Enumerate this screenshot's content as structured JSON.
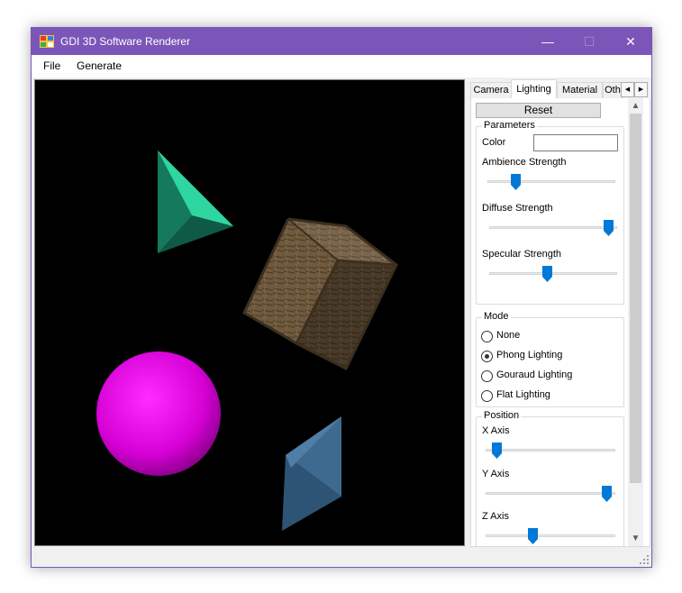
{
  "window": {
    "title": "GDI 3D Software Renderer",
    "accent_color": "#7b55b8",
    "controls": {
      "minimize": "—",
      "maximize": "☐",
      "close": "✕"
    }
  },
  "menu": {
    "items": [
      "File",
      "Generate"
    ]
  },
  "viewport": {
    "background": "#000000",
    "objects": [
      "green-pyramid",
      "wooden-crate",
      "magenta-sphere",
      "blue-bipyramid"
    ]
  },
  "panel": {
    "tabs": [
      {
        "label": "Camera",
        "active": false
      },
      {
        "label": "Lighting",
        "active": true
      },
      {
        "label": "Material",
        "active": false
      },
      {
        "label": "Oth",
        "active": false
      }
    ],
    "tab_scroll": {
      "left": "◀",
      "right": "▶"
    },
    "reset_label": "Reset",
    "parameters": {
      "title": "Parameters",
      "color_label": "Color",
      "color_value": "#ffffff",
      "ambience_label": "Ambience Strength",
      "ambience_value": 0.2,
      "diffuse_label": "Diffuse Strength",
      "diffuse_value": 0.97,
      "specular_label": "Specular Strength",
      "specular_value": 0.45
    },
    "mode": {
      "title": "Mode",
      "options": [
        {
          "label": "None",
          "checked": false
        },
        {
          "label": "Phong Lighting",
          "checked": true
        },
        {
          "label": "Gouraud Lighting",
          "checked": false
        },
        {
          "label": "Flat Lighting",
          "checked": false
        }
      ]
    },
    "position": {
      "title": "Position",
      "x_label": "X Axis",
      "x_value": 0.05,
      "y_label": "Y Axis",
      "y_value": 0.97,
      "z_label": "Z Axis",
      "z_value": 0.35
    },
    "scroll": {
      "up": "▲",
      "down": "▼"
    }
  },
  "slider_color": "#0078d7"
}
